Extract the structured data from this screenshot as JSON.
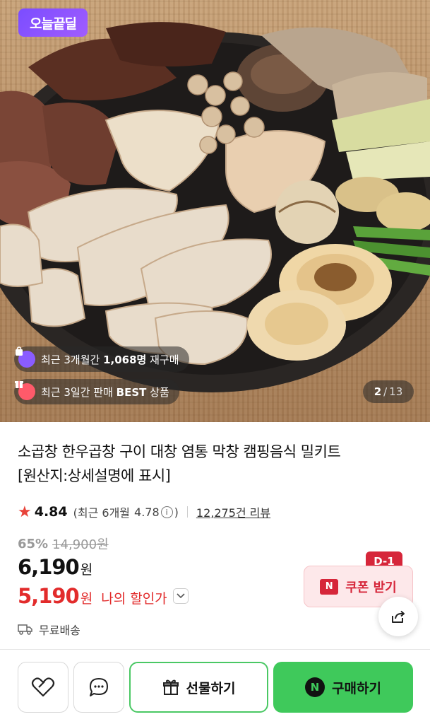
{
  "hero": {
    "deal_badge": "오늘끝딜",
    "repurchase_text_prefix": "최근 3개월간",
    "repurchase_text_bold": "1,068명",
    "repurchase_text_suffix": "재구매",
    "best_text_prefix": "최근 3일간 판매",
    "best_text_bold": "BEST",
    "best_text_suffix": "상품",
    "page_current": "2",
    "page_sep": "/",
    "page_total": "13"
  },
  "product": {
    "title_line1": "소곱창 한우곱창 구이 대창 염통 막창 캠핑음식 밀키트",
    "title_line2": "[원산지:상세설명에 표시]",
    "rating": "4.84",
    "recent_rating_label": "(최근 6개월",
    "recent_rating_value": "4.78",
    "recent_rating_close": ")",
    "review_count": "12,275건 리뷰",
    "discount_percent": "65%",
    "original_price": "14,900원",
    "price": "6,190",
    "price_unit": "원",
    "my_price": "5,190",
    "my_price_unit": "원",
    "my_discount_label": "나의 할인가",
    "delivery": "무료배송"
  },
  "coupon": {
    "d_day": "D-1",
    "logo": "N",
    "label": "쿠폰 받기"
  },
  "bottom_bar": {
    "gift_label": "선물하기",
    "buy_logo": "N",
    "buy_label": "구매하기"
  },
  "colors": {
    "accent_green": "#3fc95b",
    "sale_red": "#e22b2b",
    "deal_purple": "#7b4dff"
  },
  "icons": [
    "heart-icon",
    "chat-bubble-icon",
    "gift-icon",
    "share-icon",
    "truck-icon",
    "star-icon",
    "info-icon",
    "chevron-down-icon",
    "shopping-bag-icon",
    "gift-box-icon"
  ]
}
